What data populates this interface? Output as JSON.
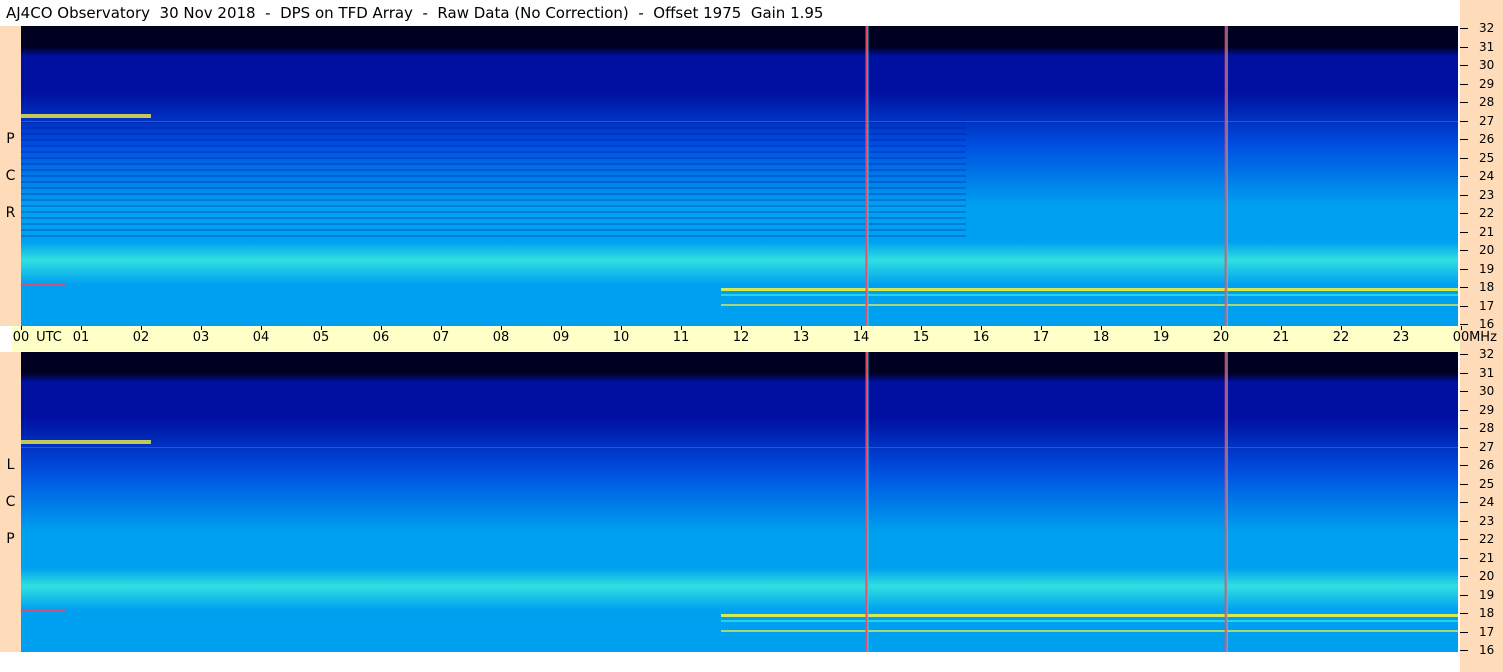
{
  "header": {
    "title": "AJ4CO Observatory  30 Nov 2018  -  DPS on TFD Array  -  Raw Data (No Correction)  -  Offset 1975  Gain 1.95"
  },
  "chart_data": [
    {
      "type": "heatmap",
      "name": "RCP",
      "channel_label": [
        "R",
        "C",
        "P"
      ],
      "x_range_hours_utc": [
        0,
        24
      ],
      "y_range_mhz": [
        16,
        32
      ],
      "y_ticks": [
        "16",
        "17",
        "18",
        "19",
        "20",
        "21",
        "22",
        "23",
        "24",
        "25",
        "26",
        "27",
        "28",
        "29",
        "30",
        "31",
        "32"
      ],
      "colormap": [
        "#000020",
        "#0010a0",
        "#0050e0",
        "#00a0f0",
        "#30e0e0",
        "#f0f040",
        "#ff4060"
      ],
      "interference_lines_utc": [
        14.12,
        20.12
      ]
    },
    {
      "type": "heatmap",
      "name": "LCP",
      "channel_label": [
        "L",
        "C",
        "P"
      ],
      "x_range_hours_utc": [
        0,
        24
      ],
      "y_range_mhz": [
        16,
        32
      ],
      "y_ticks": [
        "16",
        "17",
        "18",
        "19",
        "20",
        "21",
        "22",
        "23",
        "24",
        "25",
        "26",
        "27",
        "28",
        "29",
        "30",
        "31",
        "32"
      ],
      "colormap": [
        "#000020",
        "#0010a0",
        "#0050e0",
        "#00a0f0",
        "#30e0e0",
        "#f0f040",
        "#ff4060"
      ],
      "interference_lines_utc": [
        14.12,
        20.12
      ]
    }
  ],
  "time_axis": {
    "labels": [
      "00",
      "01",
      "02",
      "03",
      "04",
      "05",
      "06",
      "07",
      "08",
      "09",
      "10",
      "11",
      "12",
      "13",
      "14",
      "15",
      "16",
      "17",
      "18",
      "19",
      "20",
      "21",
      "22",
      "23",
      "00"
    ],
    "unit_label": "UTC",
    "freq_unit": "MHz"
  },
  "colors": {
    "background_strip": "#fedcba",
    "time_axis_bg": "#ffffc8"
  }
}
